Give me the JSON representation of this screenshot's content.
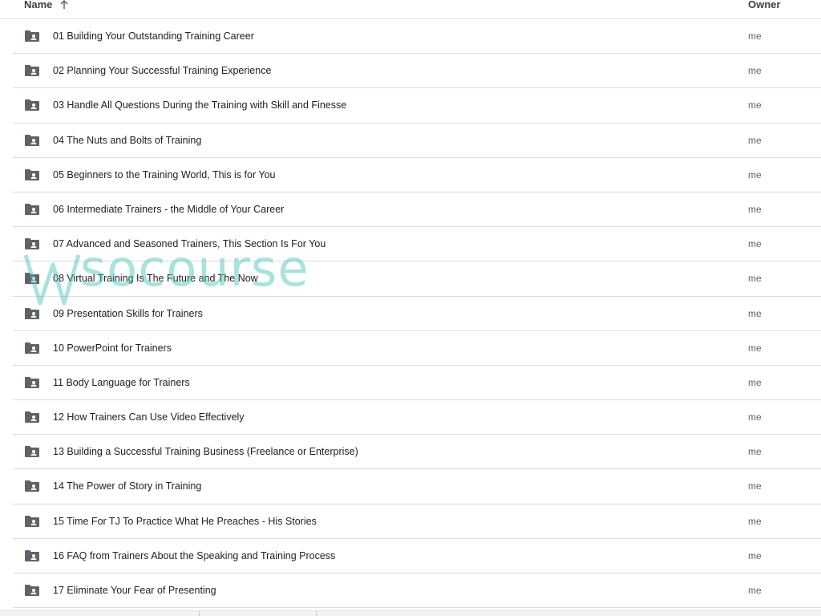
{
  "header": {
    "name_label": "Name",
    "owner_label": "Owner",
    "sort_icon": "arrow-up-icon"
  },
  "rows": [
    {
      "title": "01 Building Your Outstanding Training Career",
      "owner": "me"
    },
    {
      "title": "02 Planning Your Successful Training Experience",
      "owner": "me"
    },
    {
      "title": "03 Handle All Questions During the Training with Skill and Finesse",
      "owner": "me"
    },
    {
      "title": "04 The Nuts and Bolts of Training",
      "owner": "me"
    },
    {
      "title": "05 Beginners to the Training World, This is for You",
      "owner": "me"
    },
    {
      "title": "06 Intermediate Trainers - the Middle of Your Career",
      "owner": "me"
    },
    {
      "title": "07 Advanced and Seasoned Trainers, This Section Is For You",
      "owner": "me"
    },
    {
      "title": "08 Virtual Training Is The Future and The Now",
      "owner": "me"
    },
    {
      "title": "09 Presentation Skills for Trainers",
      "owner": "me"
    },
    {
      "title": "10 PowerPoint for Trainers",
      "owner": "me"
    },
    {
      "title": "11 Body Language for Trainers",
      "owner": "me"
    },
    {
      "title": "12 How Trainers Can Use Video Effectively",
      "owner": "me"
    },
    {
      "title": "13 Building a Successful Training Business (Freelance or Enterprise)",
      "owner": "me"
    },
    {
      "title": "14 The Power of Story in Training",
      "owner": "me"
    },
    {
      "title": "15 Time For TJ To Practice What He Preaches - His Stories",
      "owner": "me"
    },
    {
      "title": "16 FAQ from Trainers About the Speaking and Training Process",
      "owner": "me"
    },
    {
      "title": "17 Eliminate Your Fear of Presenting",
      "owner": "me"
    }
  ],
  "row_icon": "shared-folder-icon",
  "watermark": {
    "text": "socourse",
    "color": "#40beb6"
  },
  "colors": {
    "divider": "#dadce0",
    "folder_icon": "#5f6368",
    "text": "#202124"
  }
}
